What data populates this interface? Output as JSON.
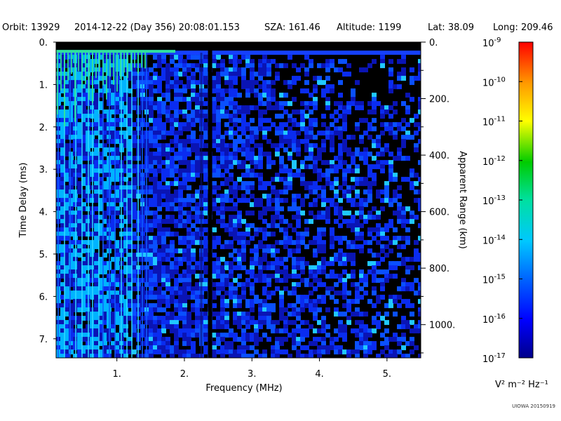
{
  "header": {
    "orbit": "Orbit: 13929",
    "datetime": "2014-12-22 (Day 356) 20:08:01.153",
    "sza": "SZA: 161.46",
    "altitude": "Altitude:   1199",
    "lat": "Lat:  38.09",
    "long": "Long: 209.46"
  },
  "footer": {
    "credit": "UIOWA 20150919"
  },
  "chart_data": {
    "type": "heatmap",
    "xlabel": "Frequency (MHz)",
    "ylabel_left": "Time Delay (ms)",
    "ylabel_right": "Apparent Range (km)",
    "xlim": [
      0.1,
      5.5
    ],
    "ylim_left": [
      0,
      7.45
    ],
    "ylim_right": [
      0,
      1117.5
    ],
    "x_ticks": [
      "1.",
      "2.",
      "3.",
      "4.",
      "5."
    ],
    "x_tick_values": [
      1,
      2,
      3,
      4,
      5
    ],
    "y_left_ticks": [
      "0.",
      "1.",
      "2.",
      "3.",
      "4.",
      "5.",
      "6.",
      "7."
    ],
    "y_left_tick_values": [
      0,
      1,
      2,
      3,
      4,
      5,
      6,
      7
    ],
    "y_right_ticks": [
      "0.",
      "200.",
      "400.",
      "600.",
      "800.",
      "1000."
    ],
    "y_right_tick_values": [
      0,
      200,
      400,
      600,
      800,
      1000
    ],
    "colorbar": {
      "label": "V² m⁻² Hz⁻¹",
      "tick_mantissa": "10",
      "tick_exponents": [
        "-9",
        "-10",
        "-11",
        "-12",
        "-13",
        "-14",
        "-15",
        "-16",
        "-17"
      ],
      "log_range": [
        -17,
        -9
      ],
      "scale": "log"
    },
    "features": {
      "dark_vertical_line_mhz": 2.38,
      "surface_reflection_delay_ms": 0.25
    }
  }
}
